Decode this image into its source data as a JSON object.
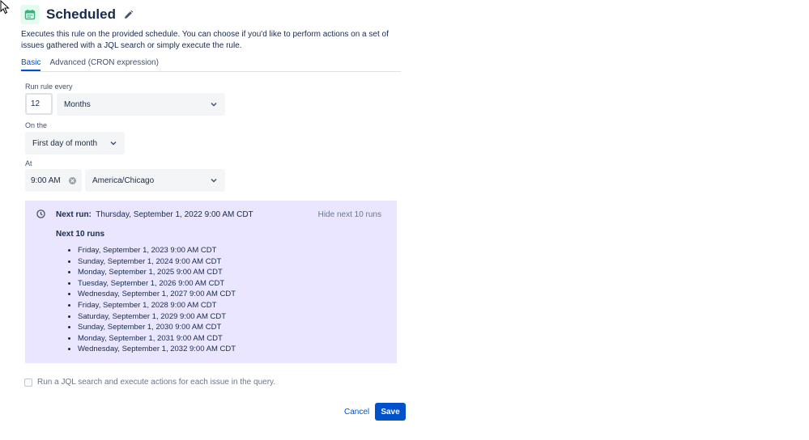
{
  "header": {
    "title": "Scheduled",
    "icon": "calendar-icon",
    "accent": "#36b37e"
  },
  "description": "Executes this rule on the provided schedule. You can choose if you'd like to perform actions on a set of issues gathered with a JQL search or simply execute the rule.",
  "tabs": [
    {
      "label": "Basic",
      "active": true
    },
    {
      "label": "Advanced (CRON expression)",
      "active": false
    }
  ],
  "form": {
    "run_rule_every_label": "Run rule every",
    "interval_value": "12",
    "interval_unit": "Months",
    "on_the_label": "On the",
    "on_the_value": "First day of month",
    "at_label": "At",
    "time_value": "9:00 AM",
    "timezone_value": "America/Chicago"
  },
  "runs": {
    "next_run_label": "Next run:",
    "next_run_value": "Thursday, September 1, 2022 9:00 AM CDT",
    "hide_link": "Hide next 10 runs",
    "next_ten_heading": "Next 10 runs",
    "items": [
      "Friday, September 1, 2023 9:00 AM CDT",
      "Sunday, September 1, 2024 9:00 AM CDT",
      "Monday, September 1, 2025 9:00 AM CDT",
      "Tuesday, September 1, 2026 9:00 AM CDT",
      "Wednesday, September 1, 2027 9:00 AM CDT",
      "Friday, September 1, 2028 9:00 AM CDT",
      "Saturday, September 1, 2029 9:00 AM CDT",
      "Sunday, September 1, 2030 9:00 AM CDT",
      "Monday, September 1, 2031 9:00 AM CDT",
      "Wednesday, September 1, 2032 9:00 AM CDT"
    ],
    "panel_color": "#eae6ff"
  },
  "jql_checkbox": {
    "label": "Run a JQL search and execute actions for each issue in the query.",
    "checked": false
  },
  "footer": {
    "cancel_label": "Cancel",
    "save_label": "Save",
    "primary_color": "#0052cc"
  }
}
